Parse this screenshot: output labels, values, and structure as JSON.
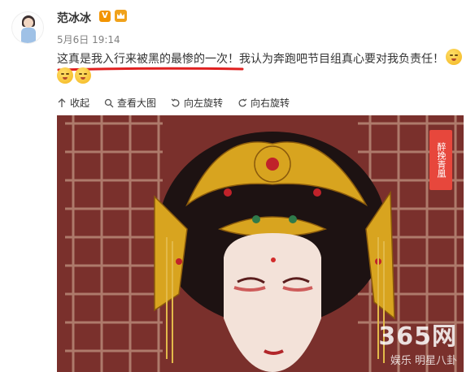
{
  "post": {
    "author": "范冰冰",
    "verified_badge": "V",
    "time": "5月6日 19:14",
    "text_highlighted": "这真是我入行来被黑的最惨的一次！",
    "text_rest": "我认为奔跑吧节目组真心要对我负责任！",
    "emoji_icon": "tearful-face-icon"
  },
  "toolbar": {
    "collapse": "收起",
    "view_large": "查看大图",
    "rotate_left": "向左旋转",
    "rotate_right": "向右旋转"
  },
  "photo": {
    "seal_text": "醉挽青凰",
    "watermark_main": "365网",
    "watermark_sub": "娱乐 明星八卦"
  },
  "colors": {
    "accent_orange": "#f29400",
    "underline_red": "#e02020",
    "link_text": "#333333"
  }
}
